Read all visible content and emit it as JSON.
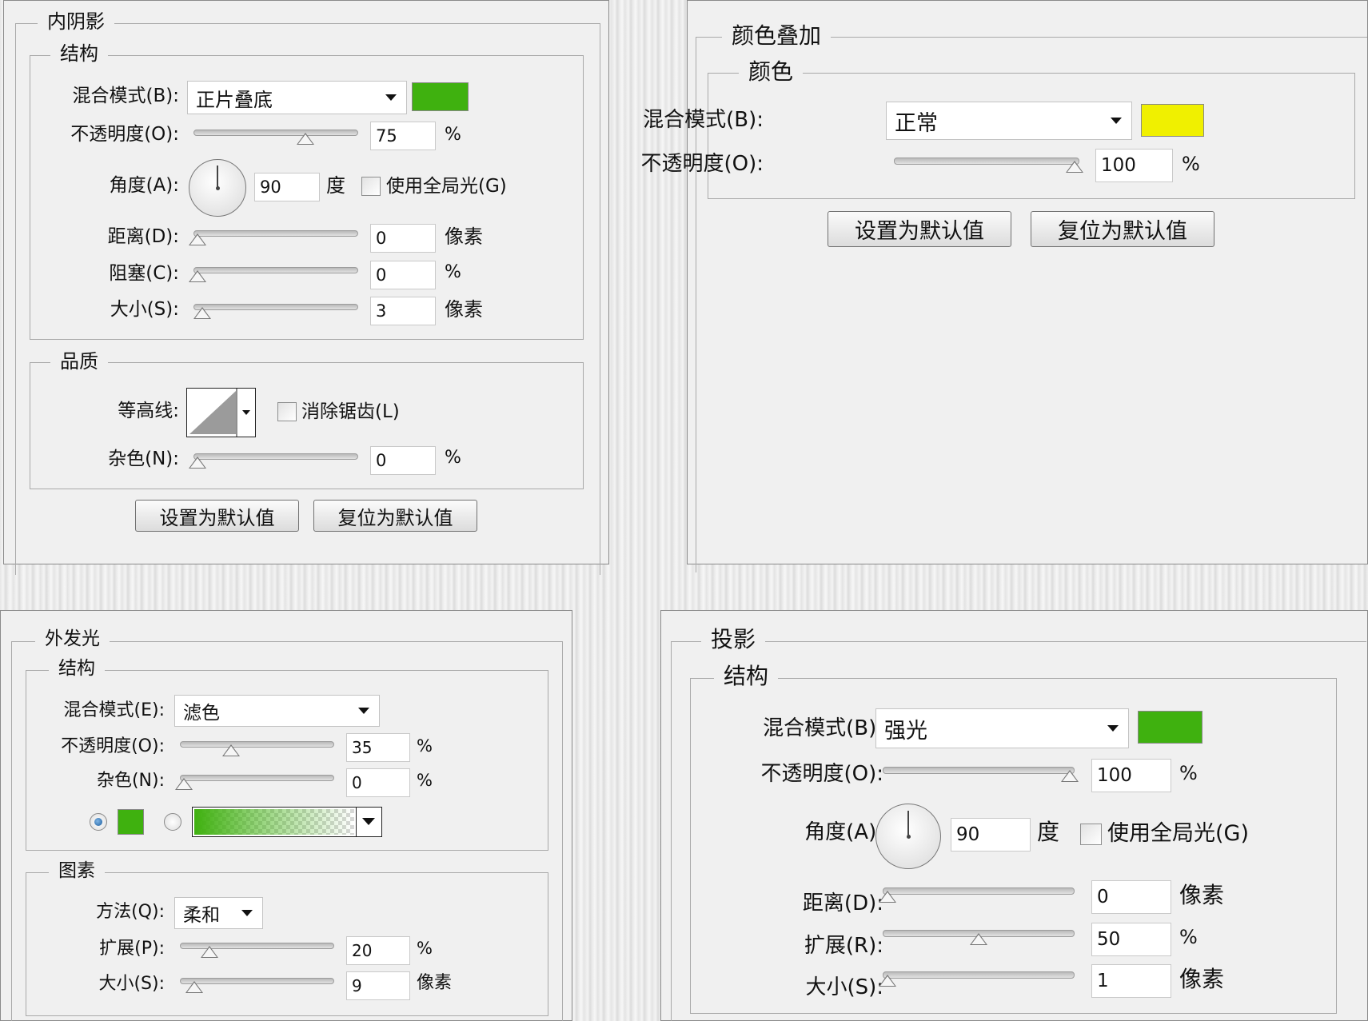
{
  "inner_shadow": {
    "title": "内阴影",
    "structure": {
      "legend": "结构",
      "blend_label": "混合模式(B):",
      "blend_value": "正片叠底",
      "color": "#3fb10f",
      "opacity_label": "不透明度(O):",
      "opacity_value": "75",
      "opacity_unit": "%",
      "angle_label": "角度(A):",
      "angle_value": "90",
      "angle_unit": "度",
      "global_light_label": "使用全局光(G)",
      "distance_label": "距离(D):",
      "distance_value": "0",
      "distance_unit": "像素",
      "choke_label": "阻塞(C):",
      "choke_value": "0",
      "choke_unit": "%",
      "size_label": "大小(S):",
      "size_value": "3",
      "size_unit": "像素"
    },
    "quality": {
      "legend": "品质",
      "contour_label": "等高线:",
      "antialias_label": "消除锯齿(L)",
      "noise_label": "杂色(N):",
      "noise_value": "0",
      "noise_unit": "%"
    },
    "set_default": "设置为默认值",
    "reset_default": "复位为默认值"
  },
  "color_overlay": {
    "title": "颜色叠加",
    "color_group": {
      "legend": "颜色",
      "blend_label": "混合模式(B):",
      "blend_value": "正常",
      "color": "#f0f000",
      "opacity_label": "不透明度(O):",
      "opacity_value": "100",
      "opacity_unit": "%"
    },
    "set_default": "设置为默认值",
    "reset_default": "复位为默认值"
  },
  "outer_glow": {
    "title": "外发光",
    "structure": {
      "legend": "结构",
      "blend_label": "混合模式(E):",
      "blend_value": "滤色",
      "opacity_label": "不透明度(O):",
      "opacity_value": "35",
      "opacity_unit": "%",
      "noise_label": "杂色(N):",
      "noise_value": "0",
      "noise_unit": "%",
      "color": "#3fb10f"
    },
    "elements": {
      "legend": "图素",
      "technique_label": "方法(Q):",
      "technique_value": "柔和",
      "spread_label": "扩展(P):",
      "spread_value": "20",
      "spread_unit": "%",
      "size_label": "大小(S):",
      "size_value": "9",
      "size_unit": "像素"
    }
  },
  "drop_shadow": {
    "title": "投影",
    "structure": {
      "legend": "结构",
      "blend_label": "混合模式(B):",
      "blend_value": "强光",
      "color": "#3fb10f",
      "opacity_label": "不透明度(O):",
      "opacity_value": "100",
      "opacity_unit": "%",
      "angle_label": "角度(A):",
      "angle_value": "90",
      "angle_unit": "度",
      "global_light_label": "使用全局光(G)",
      "distance_label": "距离(D):",
      "distance_value": "0",
      "distance_unit": "像素",
      "spread_label": "扩展(R):",
      "spread_value": "50",
      "spread_unit": "%",
      "size_label": "大小(S):",
      "size_value": "1",
      "size_unit": "像素"
    }
  }
}
